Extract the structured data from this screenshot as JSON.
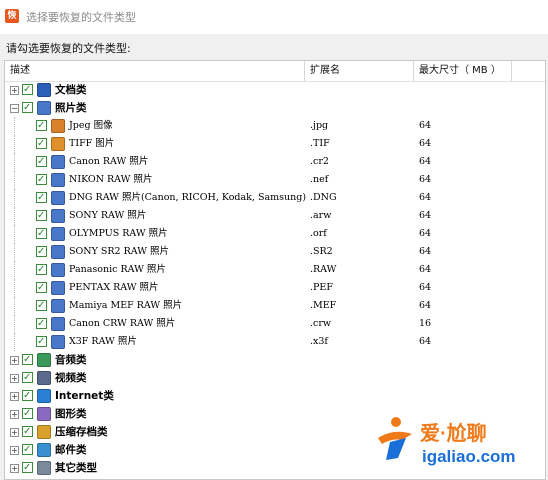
{
  "window": {
    "title": "选择要恢复的文件类型",
    "app_icon_glyph": "恢"
  },
  "instruction": "请勾选要恢复的文件类型:",
  "columns": {
    "desc": "描述",
    "ext": "扩展名",
    "size": "最大尺寸（ MB ）"
  },
  "rows": [
    {
      "kind": "cat",
      "exp": "+",
      "icon": "word-icon",
      "color": "#2b5fb8",
      "label": "文档类",
      "ext": "",
      "size": ""
    },
    {
      "kind": "cat",
      "exp": "−",
      "icon": "photo-icon",
      "color": "#4a78c8",
      "label": "照片类",
      "ext": "",
      "size": ""
    },
    {
      "kind": "item",
      "icon": "jpeg-icon",
      "color": "#d9822b",
      "label": "Jpeg 图像",
      "ext": ".jpg",
      "size": "64"
    },
    {
      "kind": "item",
      "icon": "tiff-icon",
      "color": "#e0902a",
      "label": "TIFF 图片",
      "ext": ".TIF",
      "size": "64"
    },
    {
      "kind": "item",
      "icon": "raw-icon",
      "color": "#4a78c8",
      "label": "Canon RAW 照片",
      "ext": ".cr2",
      "size": "64"
    },
    {
      "kind": "item",
      "icon": "raw-icon",
      "color": "#4a78c8",
      "label": "NIKON RAW 照片",
      "ext": ".nef",
      "size": "64"
    },
    {
      "kind": "item",
      "icon": "raw-icon",
      "color": "#4a78c8",
      "label": "DNG RAW 照片(Canon, RICOH, Kodak, Samsung)",
      "ext": ".DNG",
      "size": "64"
    },
    {
      "kind": "item",
      "icon": "raw-icon",
      "color": "#4a78c8",
      "label": "SONY RAW 照片",
      "ext": ".arw",
      "size": "64"
    },
    {
      "kind": "item",
      "icon": "raw-icon",
      "color": "#4a78c8",
      "label": "OLYMPUS RAW 照片",
      "ext": ".orf",
      "size": "64"
    },
    {
      "kind": "item",
      "icon": "raw-icon",
      "color": "#4a78c8",
      "label": "SONY SR2 RAW 照片",
      "ext": ".SR2",
      "size": "64"
    },
    {
      "kind": "item",
      "icon": "raw-icon",
      "color": "#4a78c8",
      "label": "Panasonic RAW 照片",
      "ext": ".RAW",
      "size": "64"
    },
    {
      "kind": "item",
      "icon": "raw-icon",
      "color": "#4a78c8",
      "label": "PENTAX RAW 照片",
      "ext": ".PEF",
      "size": "64"
    },
    {
      "kind": "item",
      "icon": "raw-icon",
      "color": "#4a78c8",
      "label": "Mamiya MEF RAW 照片",
      "ext": ".MEF",
      "size": "64"
    },
    {
      "kind": "item",
      "icon": "raw-icon",
      "color": "#4a78c8",
      "label": "Canon CRW RAW 照片",
      "ext": ".crw",
      "size": "16"
    },
    {
      "kind": "item",
      "icon": "raw-icon",
      "color": "#4a78c8",
      "label": "X3F RAW 照片",
      "ext": ".x3f",
      "size": "64"
    },
    {
      "kind": "cat",
      "exp": "+",
      "icon": "audio-icon",
      "color": "#3b9a5a",
      "label": "音频类",
      "ext": "",
      "size": ""
    },
    {
      "kind": "cat",
      "exp": "+",
      "icon": "video-icon",
      "color": "#5a6a8a",
      "label": "视频类",
      "ext": "",
      "size": ""
    },
    {
      "kind": "cat",
      "exp": "+",
      "icon": "internet-icon",
      "color": "#2a7fd4",
      "label": "Internet类",
      "ext": "",
      "size": ""
    },
    {
      "kind": "cat",
      "exp": "+",
      "icon": "graphics-icon",
      "color": "#8a6abf",
      "label": "图形类",
      "ext": "",
      "size": ""
    },
    {
      "kind": "cat",
      "exp": "+",
      "icon": "archive-icon",
      "color": "#d9a12b",
      "label": "压缩存档类",
      "ext": "",
      "size": ""
    },
    {
      "kind": "cat",
      "exp": "+",
      "icon": "mail-icon",
      "color": "#3a8fd0",
      "label": "邮件类",
      "ext": "",
      "size": ""
    },
    {
      "kind": "cat",
      "exp": "+",
      "icon": "other-icon",
      "color": "#7a8a9a",
      "label": "其它类型",
      "ext": "",
      "size": ""
    }
  ],
  "watermark": {
    "brand": "爱·尬聊",
    "url": "igaliao.com",
    "orange": "#f07a1a",
    "blue": "#1a6fd8"
  }
}
